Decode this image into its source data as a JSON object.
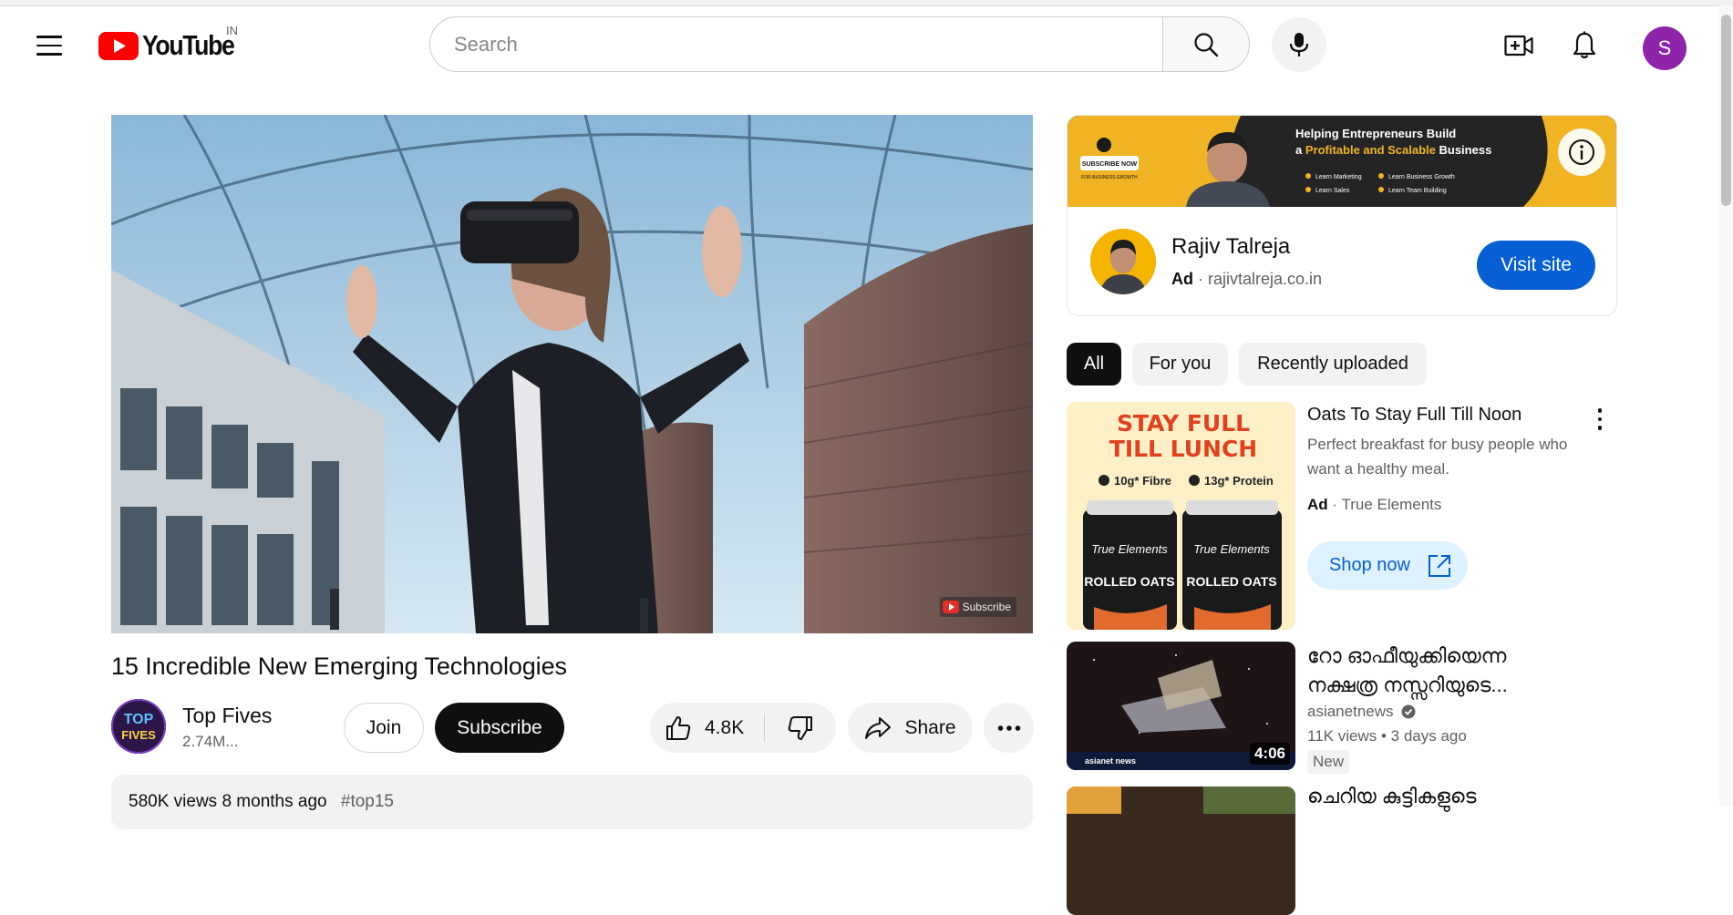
{
  "header": {
    "logo_text": "YouTube",
    "country_code": "IN",
    "search_placeholder": "Search",
    "avatar_letter": "S"
  },
  "video": {
    "title": "15 Incredible New Emerging Technologies",
    "watermark_label": "Subscribe",
    "channel": {
      "name": "Top Fives",
      "subscribers": "2.74M...",
      "avatar_text_top": "TOP",
      "avatar_text_bottom": "FIVES"
    },
    "join_label": "Join",
    "subscribe_label": "Subscribe",
    "like_count": "4.8K",
    "share_label": "Share",
    "description": {
      "views": "580K views",
      "age": "8 months ago",
      "tag": "#top15"
    }
  },
  "ad": {
    "banner": {
      "headline_1": "Helping Entrepreneurs Build",
      "headline_2a": "a ",
      "headline_2b": "Profitable and Scalable",
      "headline_2c": " Business",
      "subscribe_text": "SUBSCRIBE NOW",
      "subscribe_sub": "FOR BUSINESS GROWTH",
      "bullets": [
        "Learn Marketing",
        "Learn Business Growth",
        "Learn Sales",
        "Learn Team Building"
      ]
    },
    "advertiser": "Rajiv Talreja",
    "ad_label": "Ad",
    "domain": "rajivtalreja.co.in",
    "cta": "Visit site"
  },
  "chips": [
    {
      "label": "All",
      "active": true
    },
    {
      "label": "For you",
      "active": false
    },
    {
      "label": "Recently uploaded",
      "active": false
    }
  ],
  "recommendations": [
    {
      "title": "Oats To Stay Full Till Noon",
      "description": "Perfect breakfast for busy people who want a healthy meal.",
      "ad_label": "Ad",
      "sponsor": "True Elements",
      "cta": "Shop now",
      "thumb": {
        "headline_1": "STAY FULL",
        "headline_2": "TILL LUNCH",
        "badge_1": "10g* Fibre",
        "badge_2": "13g* Protein",
        "brand": "True Elements",
        "product": "ROLLED OATS"
      }
    },
    {
      "title_line_1": "റോ ഓഫീയുക്കിയെന്ന",
      "title_line_2": "നക്ഷത്ര നസ്സറിയുടെ...",
      "channel": "asianetnews",
      "views": "11K views",
      "age": "3 days ago",
      "duration": "4:06",
      "badge": "New",
      "thumb_brand": "asianet news"
    },
    {
      "title_line_1": "ചെറിയ കുട്ടികളുടെ"
    }
  ]
}
